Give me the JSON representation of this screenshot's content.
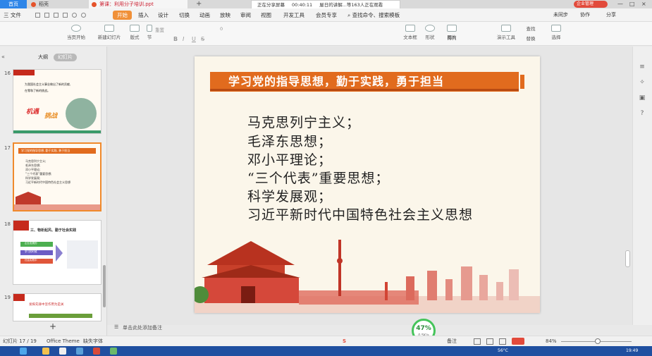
{
  "titlebar": {
    "home_tab": "首页",
    "tab2": "稻壳",
    "doc_tab": "第课：利用分子培训.ppt",
    "plus": "+",
    "share": {
      "status": "正在分享屏幕",
      "timer": "00:40:11",
      "viewers": "屋日的讲解...等163人正在观看"
    },
    "user": "企业管理",
    "min": "—",
    "max": "□",
    "close": "×"
  },
  "menubar": {
    "items": [
      "三 文件",
      "开始",
      "插入",
      "设计",
      "切换",
      "动画",
      "放映",
      "审阅",
      "视图",
      "开发工具",
      "会员专享"
    ],
    "active": "开始",
    "search": "查找命令、搜索模板",
    "right": [
      "未同步",
      "协作",
      "分享"
    ]
  },
  "ribbon": {
    "items": [
      "当页开始",
      "新建幻灯片",
      "版式",
      "节",
      "重置",
      "文本框",
      "形状",
      "排列",
      "演示工具",
      "查找",
      "替换",
      "选择",
      "图片"
    ],
    "font_size": "0",
    "bold": "B",
    "italic": "I",
    "underline": "U",
    "strike": "S"
  },
  "leftpanel": {
    "tabs": [
      "大纲",
      "幻灯片"
    ],
    "active_tab": "幻灯片",
    "slides": [
      {
        "num": "16",
        "text1": "为我国社会主义事业做出了新的贡献,",
        "text2": "在零和了新的挑战。",
        "tag1": "机遇",
        "tag2": "挑战"
      },
      {
        "num": "17",
        "title": "学习党的指导思想, 勤于实践, 勇于担当",
        "lines": [
          "马克思列宁主义;",
          "毛泽东思想;",
          "邓小平理论;",
          "“三个代表”重要思想;",
          "科学发展观;",
          "习近平新时代中国特色社会主义思想"
        ]
      },
      {
        "num": "18",
        "title": "三、物析起风、勤于社会实践",
        "items": [
          "企业发展的",
          "学习的时候",
          "社会实践中"
        ]
      },
      {
        "num": "19",
        "title": "发挥先锋中坚作用为是关"
      }
    ],
    "add": "+"
  },
  "slide": {
    "title": "学习党的指导思想，勤于实践，勇于担当",
    "lines": [
      "马克思列宁主义；",
      "毛泽东思想；",
      "邓小平理论；",
      "“三个代表”重要思想；",
      "科学发展观；",
      "习近平新时代中国特色社会主义思想"
    ]
  },
  "notes": {
    "placeholder": "单击此处添加备注"
  },
  "statusbar": {
    "slide_info": "幻灯片 17 / 19",
    "theme": "Office Theme",
    "font_missing": "缺失字体",
    "zoom": "84%",
    "notes_btn": "备注"
  },
  "progress_ring": {
    "value": "47%",
    "sub": "0.5K/s"
  },
  "taskbar": {
    "temp": "56°C",
    "time": "19:49"
  },
  "colors": {
    "accent": "#e16b1e",
    "home_tab": "#2f86e8",
    "taskbar": "#1f4fa0",
    "active_menu": "#f09038"
  }
}
